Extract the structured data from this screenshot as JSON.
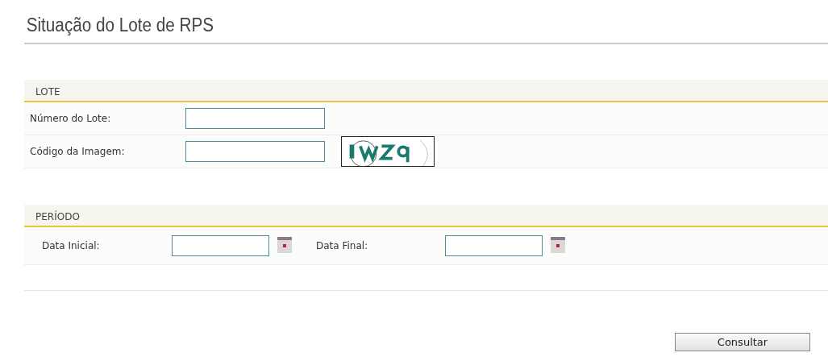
{
  "title": "Situação do Lote de RPS",
  "sections": [
    {
      "heading": "LOTE",
      "kind": "stacked",
      "fields": [
        {
          "label": "Número do Lote:",
          "kind": "text"
        },
        {
          "label": "Código da Imagem:",
          "kind": "captcha"
        }
      ]
    },
    {
      "heading": "PERÍODO",
      "kind": "inline",
      "fields": [
        {
          "label": "Data Inicial:",
          "kind": "date"
        },
        {
          "label": "Data Final:",
          "kind": "date"
        }
      ]
    }
  ],
  "button": "Consultar"
}
